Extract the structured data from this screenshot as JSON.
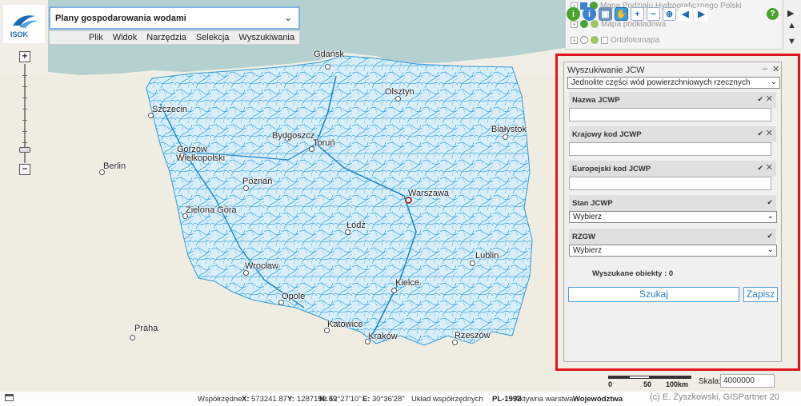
{
  "header": {
    "logo_text": "ISOK",
    "app_title": "Plany gospodarowania wodami",
    "menu": [
      "Plik",
      "Widok",
      "Narzędzia",
      "Selekcja",
      "Wyszukiwania"
    ]
  },
  "layers": {
    "items": [
      {
        "label": "Mapa Podziału Hydrograficznego Polski"
      },
      {
        "label": "Mapa podkładowa"
      },
      {
        "label": "Ortofotomapa"
      }
    ]
  },
  "map": {
    "cities": [
      {
        "name": "Gdańsk"
      },
      {
        "name": "Olsztyn"
      },
      {
        "name": "Szczecin"
      },
      {
        "name": "Białystok"
      },
      {
        "name": "Bydgoszcz"
      },
      {
        "name": "Toruń"
      },
      {
        "name": "Gorzów"
      },
      {
        "name": "Wielkopolski"
      },
      {
        "name": "Berlin"
      },
      {
        "name": "Poznań"
      },
      {
        "name": "Warszawa"
      },
      {
        "name": "Zielona Góra"
      },
      {
        "name": "Łódź"
      },
      {
        "name": "Lublin"
      },
      {
        "name": "Wrocław"
      },
      {
        "name": "Kielce"
      },
      {
        "name": "Opole"
      },
      {
        "name": "Praha"
      },
      {
        "name": "Katowice"
      },
      {
        "name": "Kraków"
      },
      {
        "name": "Rzeszów"
      }
    ]
  },
  "search_panel": {
    "title": "Wyszukiwanie JCW",
    "type_select": "Jednolite części wód powierzchniowych rzecznych",
    "fields": [
      {
        "label": "Nazwa JCWP",
        "value": ""
      },
      {
        "label": "Krajowy kod JCWP",
        "value": ""
      },
      {
        "label": "Europejski kod JCWP",
        "value": ""
      }
    ],
    "stan_label": "Stan JCWP",
    "stan_value": "Wybierz",
    "rzgw_label": "RZGW",
    "rzgw_value": "Wybierz",
    "found_text": "Wyszukane obiekty : 0",
    "search_button": "Szukaj",
    "save_button": "Zapisz"
  },
  "scale": {
    "bar_labels": [
      "0",
      "50",
      "100km"
    ],
    "label": "Skala:",
    "value": "4000000"
  },
  "status": {
    "coords_label": "Współrzędne",
    "x_label": "X:",
    "x_value": "573241.87",
    "y_label": "Y:",
    "y_value": "1287159.49",
    "n_label": "N:",
    "n_value": "52°27'10\"",
    "e_label": "E:",
    "e_value": "30°36'28\"",
    "system_label": "Układ współrzędnych",
    "system_value": "PL-1992",
    "active_layer_label": "Aktywna warstwa",
    "active_layer_value": "Województwa",
    "copyright": "(c) E. Żyszkowski, GISPartner 20"
  },
  "colors": {
    "accent": "#1b69b3",
    "highlight_frame": "#e0141d",
    "river": "#3aa6e0",
    "sea": "#b5d0d0"
  }
}
